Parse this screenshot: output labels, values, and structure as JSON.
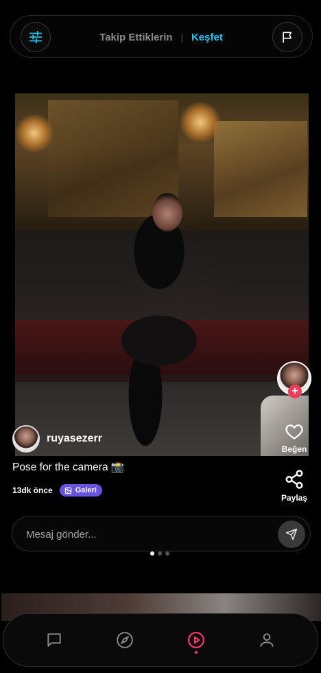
{
  "header": {
    "tab_following": "Takip Ettiklerin",
    "separator": "|",
    "tab_explore": "Keşfet",
    "active_tab": "Keşfet",
    "accent_color": "#21c7ee"
  },
  "post": {
    "author": "ruyasezerr",
    "caption": "Pose for the camera 📸",
    "time_ago": "13dk önce",
    "badge_label": "Galeri",
    "badge_color": "#6654e0",
    "follow_badge": "+",
    "like_label": "Beğen",
    "share_label": "Paylaş"
  },
  "message": {
    "placeholder": "Mesaj gönder..."
  },
  "carousel": {
    "count": 3,
    "active_index": 0
  },
  "nav": {
    "items": [
      {
        "icon": "chat-icon"
      },
      {
        "icon": "compass-icon"
      },
      {
        "icon": "play-circle-icon",
        "active": true
      },
      {
        "icon": "user-icon"
      }
    ],
    "active_color": "#ff3b6b"
  }
}
